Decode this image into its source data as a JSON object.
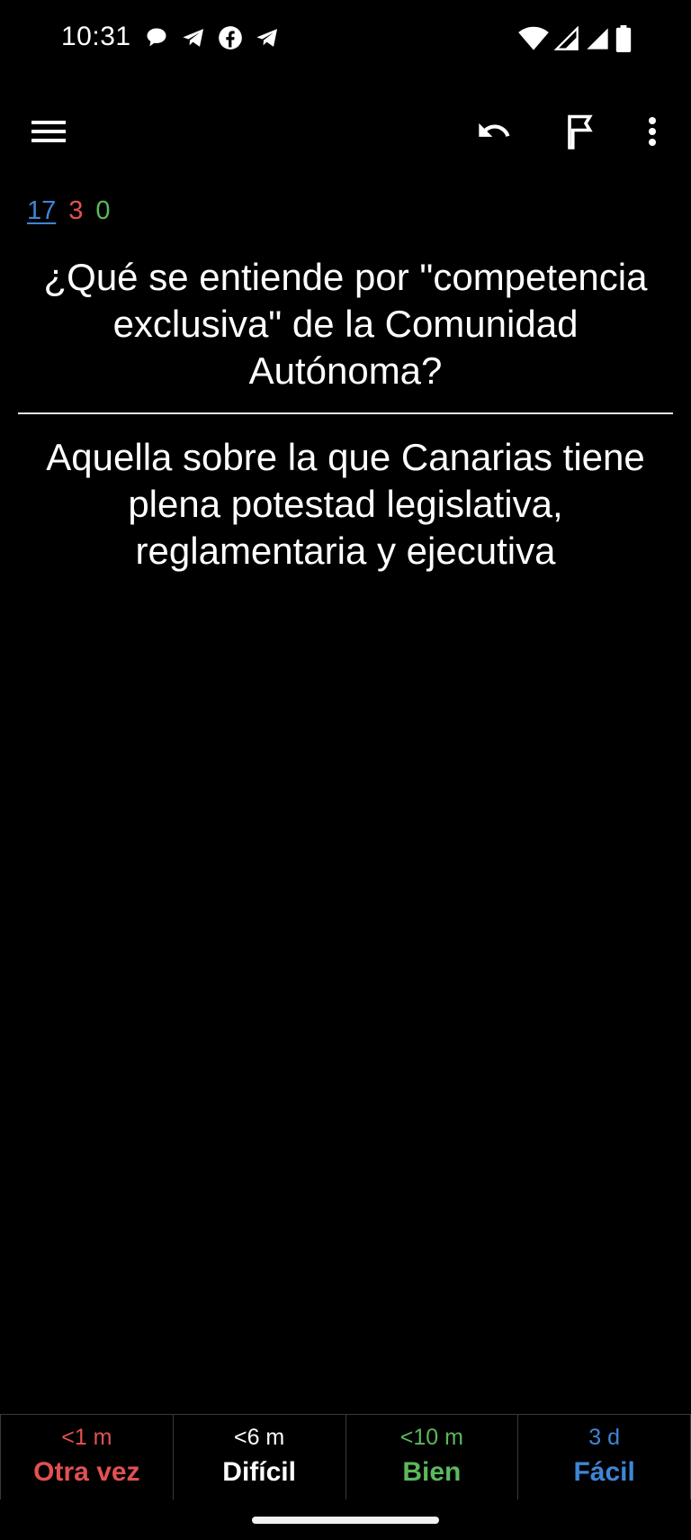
{
  "status_bar": {
    "time": "10:31",
    "notification_icons": [
      "chat-bubble-icon",
      "telegram-icon",
      "facebook-icon",
      "telegram-icon"
    ],
    "system_icons": [
      "wifi-icon",
      "signal-icon",
      "signal-icon",
      "battery-icon"
    ]
  },
  "toolbar": {
    "menu_icon": "hamburger-menu-icon",
    "undo_icon": "undo-icon",
    "flag_icon": "flag-icon",
    "more_icon": "more-vert-icon"
  },
  "counts": {
    "new": "17",
    "learning": "3",
    "review": "0"
  },
  "card": {
    "question": "¿Qué se entiende por \"competencia exclusiva\" de la Comunidad Autónoma?",
    "answer": "Aquella sobre la que Canarias tiene plena potestad legislativa, reglamentaria y ejecutiva"
  },
  "answer_buttons": [
    {
      "interval": "<1 m",
      "label": "Otra vez",
      "color": "#e25151"
    },
    {
      "interval": "<6 m",
      "label": "Difícil",
      "color": "#ffffff"
    },
    {
      "interval": "<10 m",
      "label": "Bien",
      "color": "#5cb85c"
    },
    {
      "interval": "3 d",
      "label": "Fácil",
      "color": "#3e86d6"
    }
  ],
  "colors": {
    "background": "#000000",
    "new_count": "#3e86d6",
    "learning_count": "#e25151",
    "review_count": "#5cb85c"
  }
}
